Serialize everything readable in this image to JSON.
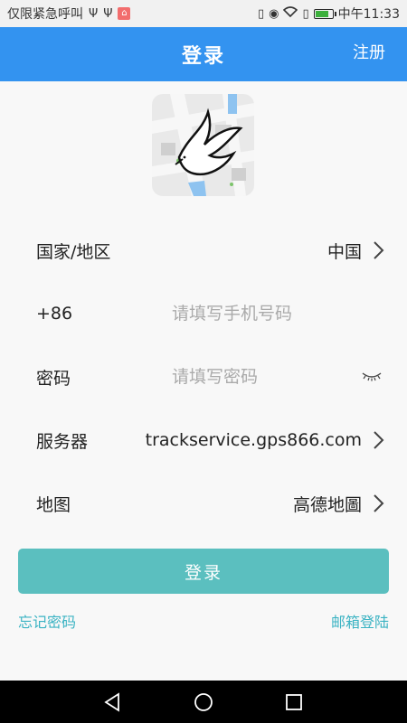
{
  "status_bar": {
    "carrier_text": "仅限紧急呼叫",
    "usb_icons": [
      "usb-icon",
      "usb-icon"
    ],
    "time": "中午11:33"
  },
  "header": {
    "title": "登录",
    "register_label": "注册"
  },
  "form": {
    "region": {
      "label": "国家/地区",
      "value": "中国"
    },
    "phone": {
      "label": "+86",
      "placeholder": "请填写手机号码",
      "value": ""
    },
    "password": {
      "label": "密码",
      "placeholder": "请填写密码",
      "value": ""
    },
    "server": {
      "label": "服务器",
      "value": "trackservice.gps866.com"
    },
    "map": {
      "label": "地图",
      "value": "高德地圖"
    }
  },
  "login_button_label": "登录",
  "links": {
    "forgot_password": "忘记密码",
    "email_login": "邮箱登陆"
  },
  "colors": {
    "header_bg": "#3393f0",
    "button_bg": "#5bbfbf",
    "link": "#3bb3c3"
  }
}
